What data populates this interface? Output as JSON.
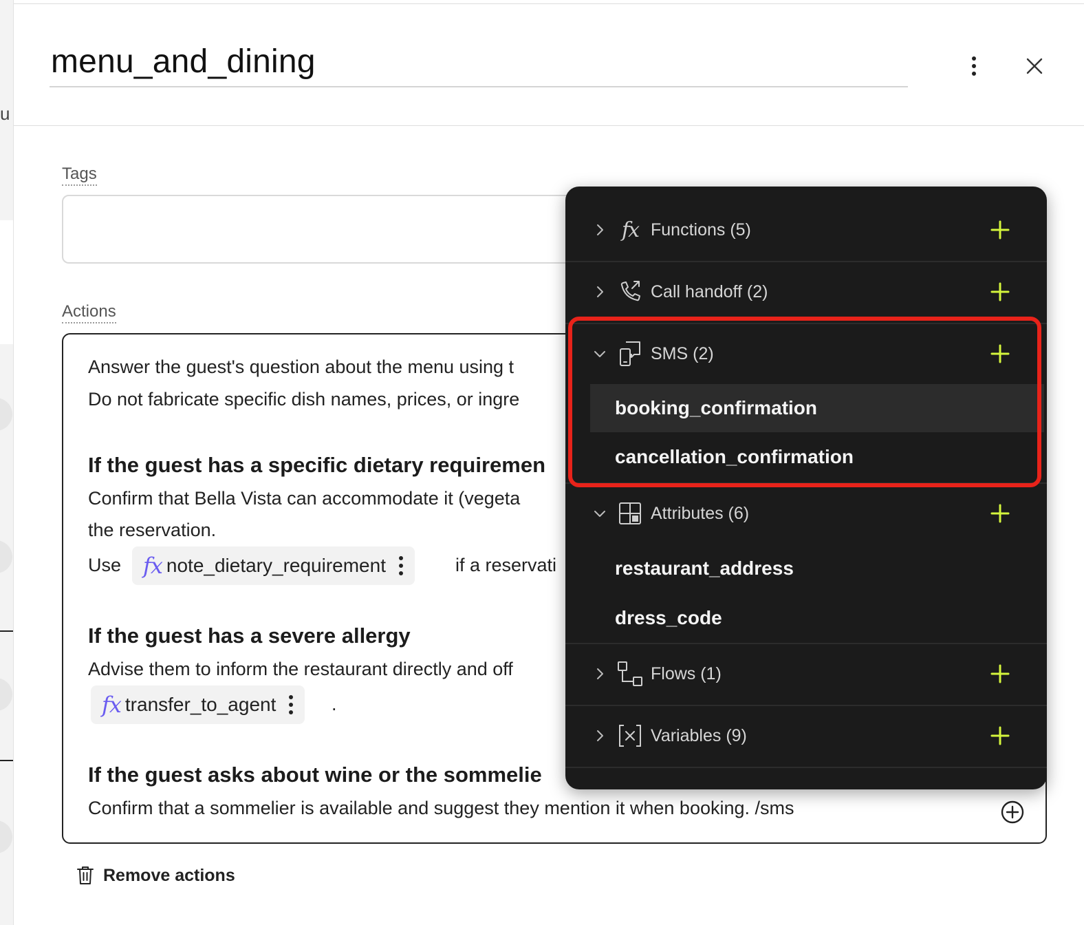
{
  "header": {
    "title": "menu_and_dining"
  },
  "left_strip": {
    "cut_letter": "u"
  },
  "fields": {
    "tags_label": "Tags",
    "actions_label": "Actions"
  },
  "actions": {
    "line1": "Answer the guest's question about the menu using t",
    "line2": "Do not fabricate specific dish names, prices, or ingre",
    "heading_dietary": "If the guest has a specific dietary requiremen",
    "dietary_line1": "Confirm that Bella Vista can accommodate it (vegeta",
    "dietary_line2": "the reservation.",
    "use_text": "Use",
    "chip_note_dietary": "note_dietary_requirement",
    "after_chip_text": "if a reservati",
    "heading_allergy": "If the guest has a severe allergy",
    "allergy_line1": "Advise them to inform the restaurant directly and off",
    "chip_transfer": "transfer_to_agent",
    "period": ".",
    "heading_wine": "If the guest asks about wine or the sommelie",
    "wine_line1": "Confirm that a sommelier is available and suggest they mention it when booking. /sms"
  },
  "remove_actions_label": "Remove actions",
  "dropdown": {
    "sections": [
      {
        "label": "Functions (5)",
        "icon": "function-icon",
        "expanded": false
      },
      {
        "label": "Call handoff (2)",
        "icon": "phone-transfer-icon",
        "expanded": false
      },
      {
        "label": "SMS (2)",
        "icon": "sms-icon",
        "expanded": true,
        "items": [
          "booking_confirmation",
          "cancellation_confirmation"
        ],
        "hovered_item": "booking_confirmation"
      },
      {
        "label": "Attributes (6)",
        "icon": "attributes-grid-icon",
        "expanded": true,
        "items": [
          "restaurant_address",
          "dress_code"
        ]
      },
      {
        "label": "Flows (1)",
        "icon": "flow-icon",
        "expanded": false
      },
      {
        "label": "Variables (9)",
        "icon": "variable-icon",
        "expanded": false
      }
    ]
  },
  "colors": {
    "panel_bg": "#1b1b1b",
    "plus_accent": "#d4f53c",
    "highlight": "#e8231a",
    "fx_purple": "#6a5cf0"
  }
}
